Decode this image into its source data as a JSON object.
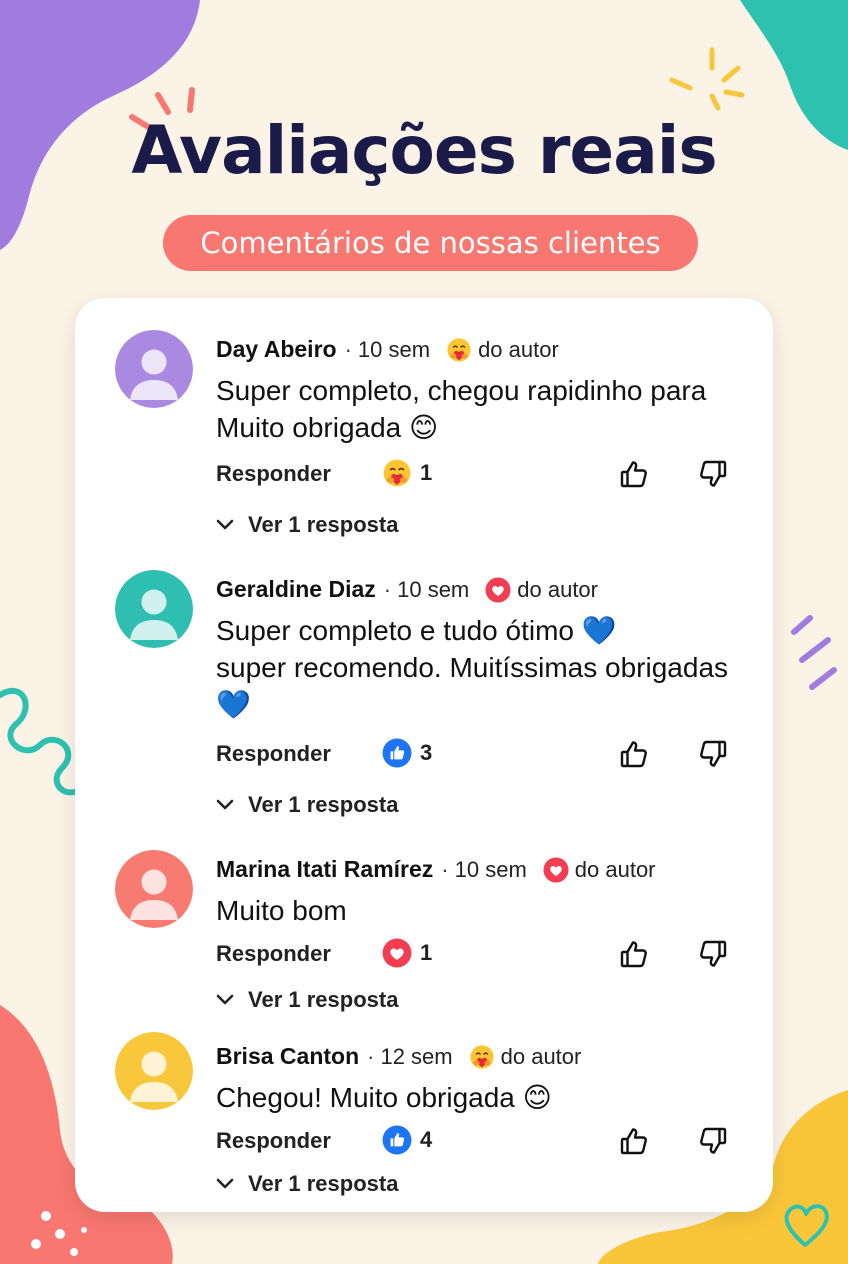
{
  "header": {
    "title": "Avaliações reais",
    "subtitle": "Comentários de nossas clientes"
  },
  "colors": {
    "background": "#fbf3e6",
    "title": "#1b1b4a",
    "pill": "#f87770",
    "purple": "#a07cdf",
    "teal": "#2ec1b0",
    "coral": "#f87770",
    "yellow": "#f9c63a"
  },
  "comments": [
    {
      "name": "Day Abeiro",
      "time": "10 sem",
      "author_reaction_icon": "hug-emoji-icon",
      "author_label": "do autor",
      "avatar_color": "#a98ae0",
      "text_lines": [
        "Super completo, chegou rapidinho para",
        "Muito obrigada 😊"
      ],
      "reply_label": "Responder",
      "reaction_icon": "hug-emoji-icon",
      "reaction_count": "1",
      "replies_label": "Ver 1 resposta"
    },
    {
      "name": "Geraldine Diaz",
      "time": "10 sem",
      "author_reaction_icon": "heart-icon",
      "author_label": "do autor",
      "avatar_color": "#2fbfb0",
      "text_lines": [
        "Super completo e tudo ótimo 💙",
        "super recomendo. Muitíssimas obrigadas",
        "💙"
      ],
      "reply_label": "Responder",
      "reaction_icon": "like-icon",
      "reaction_count": "3",
      "replies_label": "Ver 1 resposta"
    },
    {
      "name": "Marina Itati Ramírez",
      "time": "10 sem",
      "author_reaction_icon": "heart-icon",
      "author_label": "do autor",
      "avatar_color": "#f87b72",
      "text_lines": [
        "Muito bom"
      ],
      "reply_label": "Responder",
      "reaction_icon": "heart-icon",
      "reaction_count": "1",
      "replies_label": "Ver 1 resposta"
    },
    {
      "name": "Brisa Canton",
      "time": "12 sem",
      "author_reaction_icon": "hug-emoji-icon",
      "author_label": "do autor",
      "avatar_color": "#f8c73c",
      "text_lines": [
        "Chegou! Muito obrigada 😊"
      ],
      "reply_label": "Responder",
      "reaction_icon": "like-icon",
      "reaction_count": "4",
      "replies_label": "Ver 1 resposta"
    }
  ]
}
